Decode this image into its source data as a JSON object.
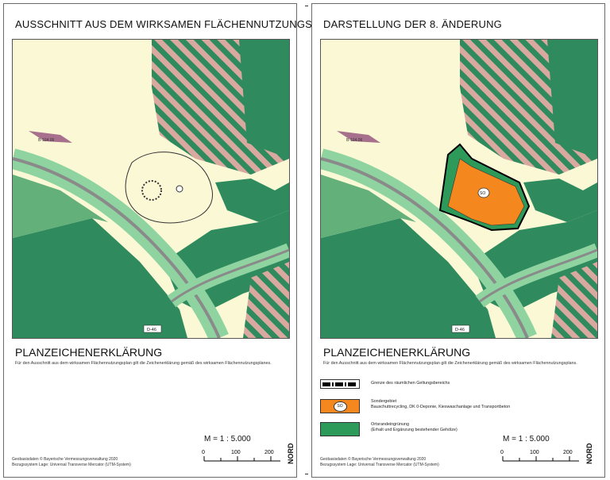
{
  "left": {
    "title": "AUSSCHNITT AUS DEM WIRKSAMEN FLÄCHENNUTZUNGSPLAN",
    "legend_title": "PLANZEICHENERKLÄRUNG",
    "legend_note": "Für den Ausschnitt aus dem wirksamen Flächennutzungsplan gilt die Zeichenerklärung gemäß des wirksamen Flächennutzungsplanes.",
    "scale": "M = 1 : 5.000",
    "credits": [
      "Geobasisdaten © Bayerische Vermessungsverwaltung 2020",
      "Bezugssystem Lage:    Universal Transverse Mercator (UTM-System)"
    ]
  },
  "right": {
    "title": "DARSTELLUNG DER 8. ÄNDERUNG",
    "legend_title": "PLANZEICHENERKLÄRUNG",
    "legend_note": "Für den Ausschnitt aus dem wirksamen Flächennutzungsplan gilt die Zeichenerklärung gemäß des wirksamen Flächennutzungsplans.",
    "legend_items": [
      {
        "symbol": "boundary",
        "text": "Grenze des räumlichen Geltungsbereichs"
      },
      {
        "symbol": "SO",
        "text": "Sondergebiet\nBauschuttrecycling, DK 0-Deponie, Kieswaschanlage und Transportbeton"
      },
      {
        "symbol": "green",
        "text": "Ortsrandeingrünung\n(Erhalt und Ergänzung bestehender Gehölze)"
      }
    ],
    "scale": "M = 1 : 5.000",
    "credits": [
      "Geobasisdaten © Bayerische Vermessungsverwaltung 2020",
      "Bezugssystem Lage:    Universal Transverse Mercator (UTM-System)"
    ]
  },
  "map_labels": {
    "road": "D-46",
    "parcel": "B-104.06",
    "so": "SO"
  },
  "scalebar_ticks": [
    "0",
    "100",
    "200"
  ],
  "north_label": "NORD",
  "colors": {
    "field": "#fbf8d6",
    "dark_green": "#2f8a5e",
    "mid_green": "#64b07a",
    "hatch_pink": "#d9a9a0",
    "road_green": "#8fd4a0",
    "special_area": "#f5871f"
  }
}
